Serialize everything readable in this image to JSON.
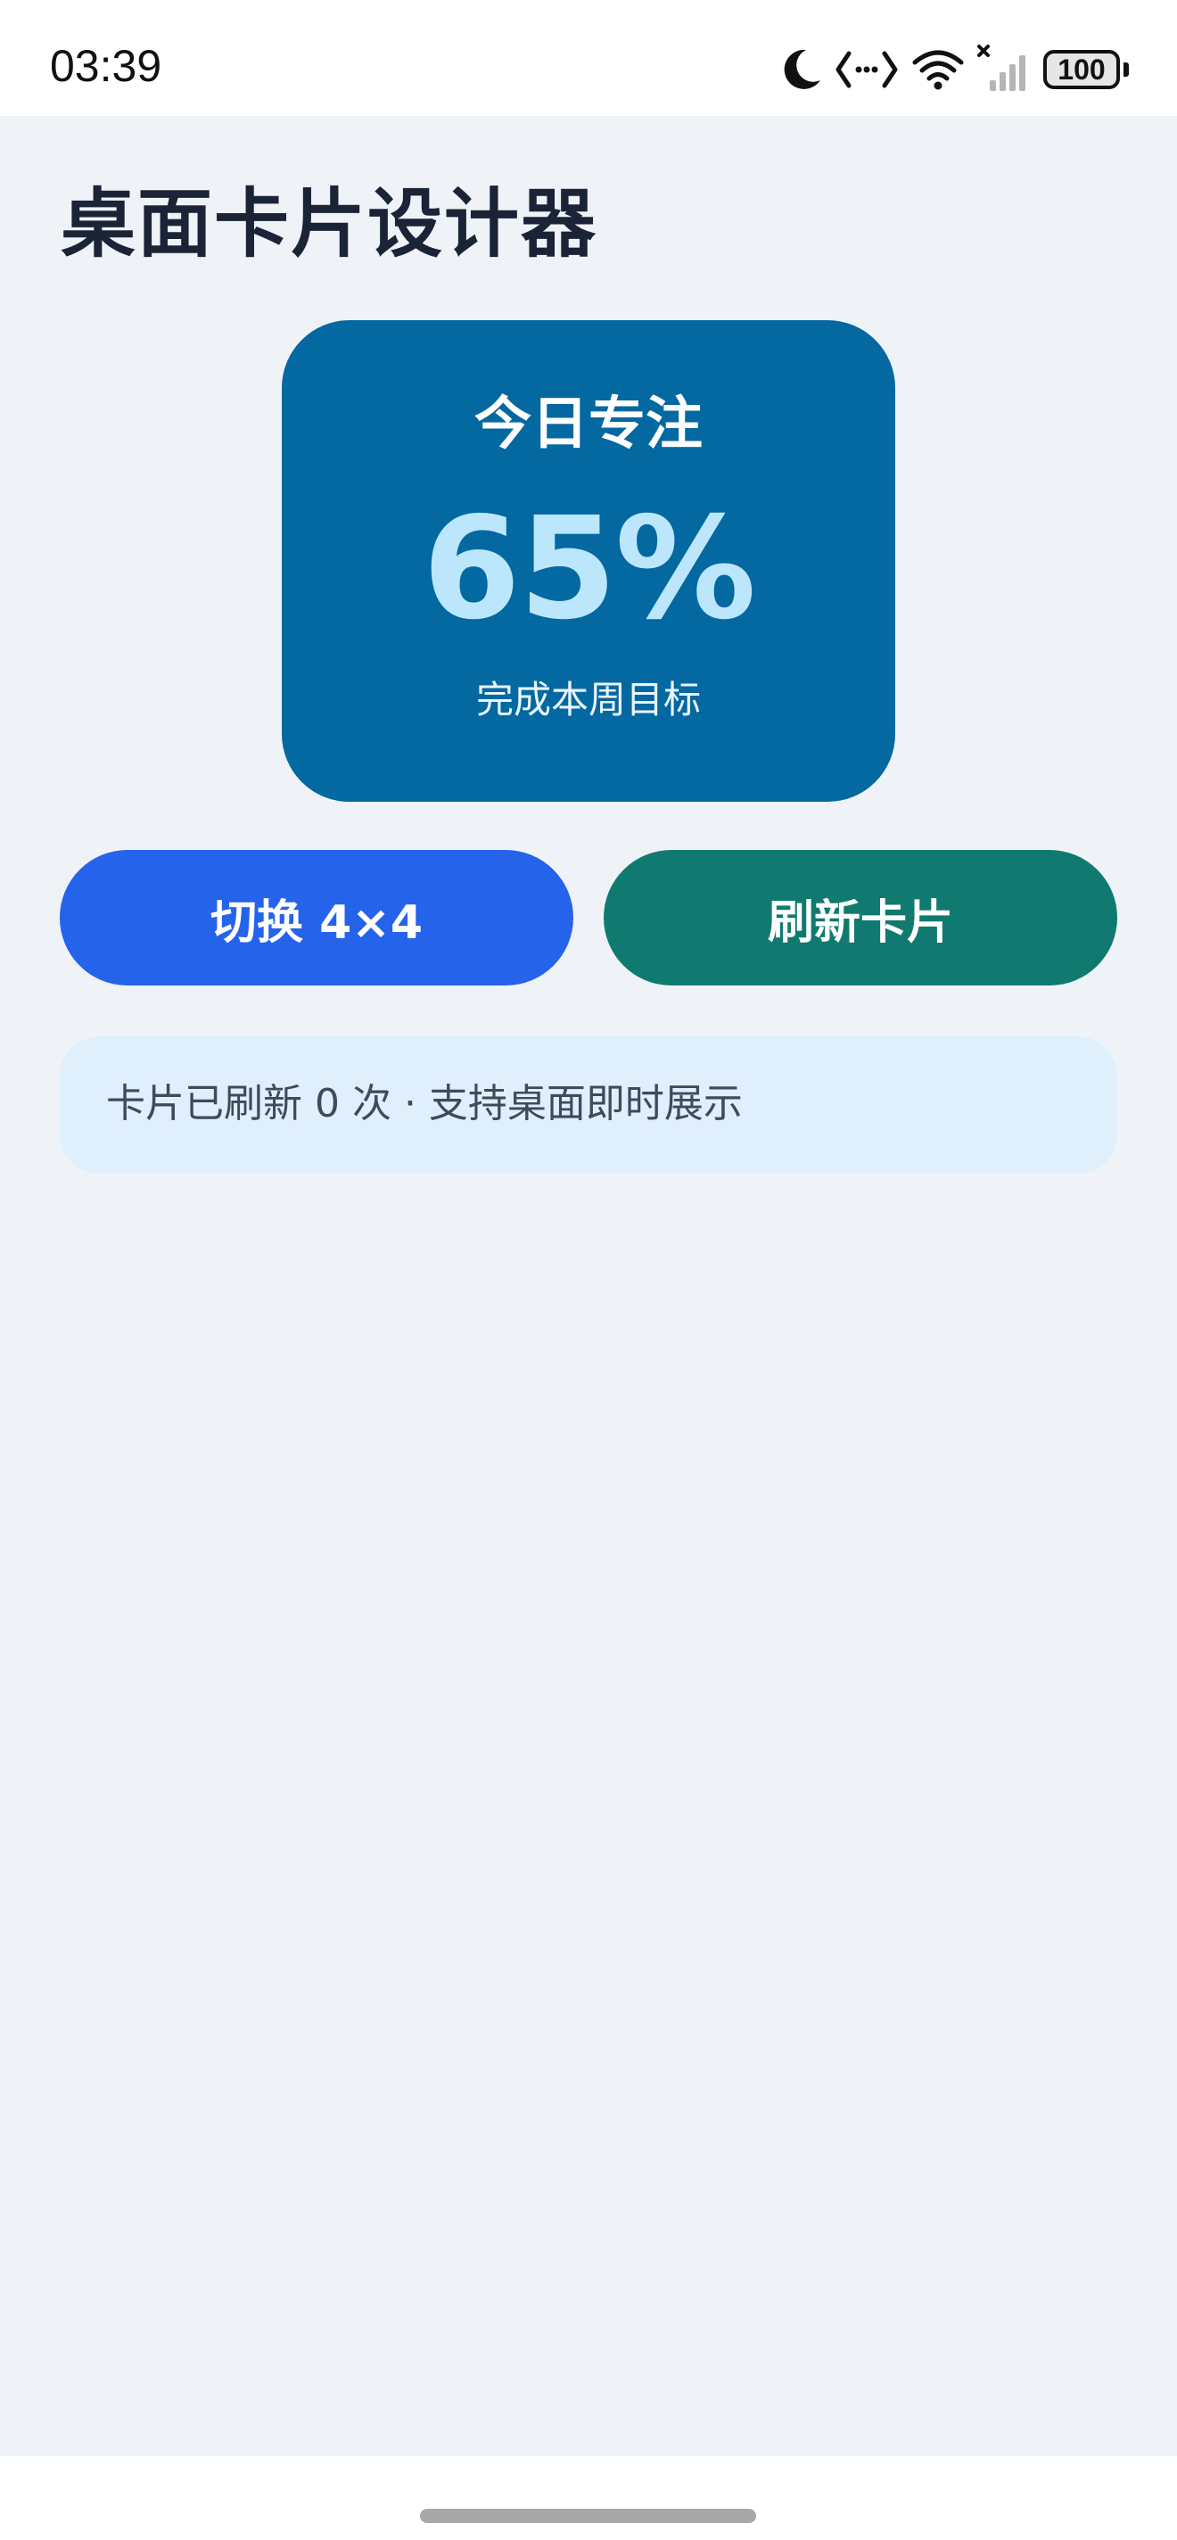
{
  "status_bar": {
    "time": "03:39",
    "battery_level": "100",
    "icons": [
      "moon-icon",
      "code-icon",
      "wifi-icon",
      "signal-icon",
      "battery-icon"
    ]
  },
  "page": {
    "title": "桌面卡片设计器"
  },
  "widget": {
    "title": "今日专注",
    "value": "65%",
    "subtitle": "完成本周目标",
    "background_color": "#0468a1",
    "value_color": "#bce6fb"
  },
  "buttons": {
    "toggle_label": "切换 4×4",
    "toggle_color": "#2563eb",
    "refresh_label": "刷新卡片",
    "refresh_color": "#107a70"
  },
  "info": {
    "text": "卡片已刷新 0 次 · 支持桌面即时展示"
  }
}
